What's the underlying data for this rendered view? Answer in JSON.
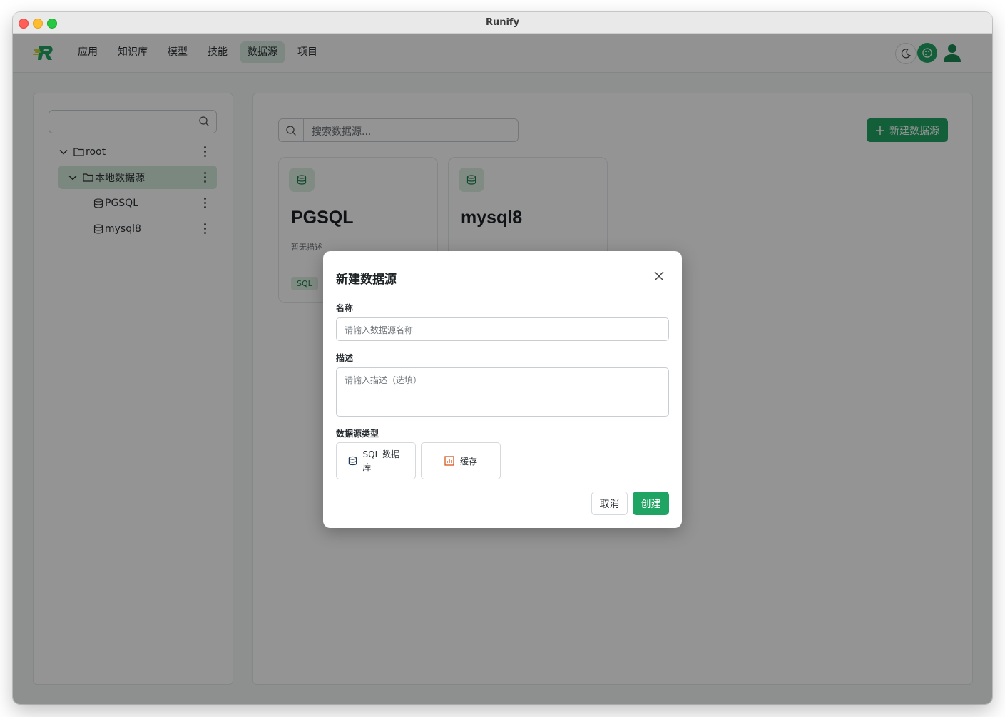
{
  "window": {
    "title": "Runify"
  },
  "nav": {
    "items": [
      {
        "label": "应用"
      },
      {
        "label": "知识库"
      },
      {
        "label": "模型"
      },
      {
        "label": "技能"
      },
      {
        "label": "数据源",
        "active": true
      },
      {
        "label": "项目"
      }
    ],
    "icons": [
      "moon-icon",
      "palette-icon",
      "user-icon"
    ]
  },
  "sidebar": {
    "search_value": "",
    "tree": [
      {
        "label": "root",
        "icon": "folder-icon",
        "expanded": true
      },
      {
        "label": "本地数据源",
        "icon": "folder-icon",
        "expanded": true,
        "selected": true
      },
      {
        "label": "PGSQL",
        "icon": "database-icon"
      },
      {
        "label": "mysql8",
        "icon": "database-icon"
      }
    ]
  },
  "main": {
    "search_placeholder": "搜索数据源...",
    "new_button_label": "新建数据源",
    "cards": [
      {
        "name": "PGSQL",
        "desc": "暂无描述",
        "tag": "SQL"
      },
      {
        "name": "mysql8"
      }
    ]
  },
  "modal": {
    "title": "新建数据源",
    "name_label": "名称",
    "name_placeholder": "请输入数据源名称",
    "desc_label": "描述",
    "desc_placeholder": "请输入描述（选填）",
    "type_label": "数据源类型",
    "types": [
      {
        "label": "SQL 数据库",
        "icon": "database-icon"
      },
      {
        "label": "缓存",
        "icon": "bar-chart-icon"
      }
    ],
    "cancel_label": "取消",
    "create_label": "创建"
  },
  "colors": {
    "accent": "#1fa463",
    "accent_light": "#dcefe4"
  }
}
